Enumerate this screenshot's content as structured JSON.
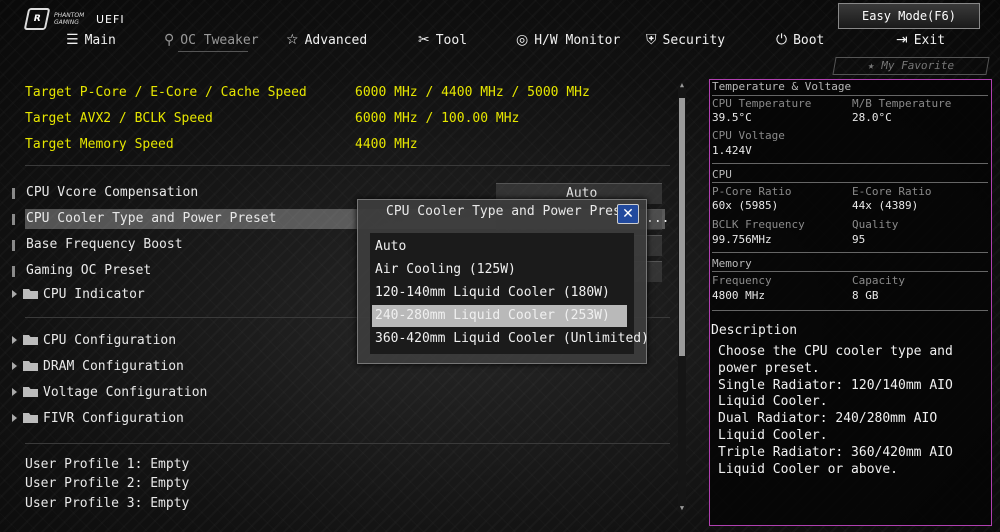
{
  "brand": {
    "logo_line1": "PHANTOM",
    "logo_line2": "GAMING",
    "logo_mark": "R",
    "uefi": "UEFI"
  },
  "header": {
    "easy_mode": "Easy Mode(F6)",
    "my_favorite": "My Favorite"
  },
  "nav": [
    {
      "label": "Main",
      "icon": "list-icon"
    },
    {
      "label": "OC Tweaker",
      "icon": "rocket-icon"
    },
    {
      "label": "Advanced",
      "icon": "star-icon"
    },
    {
      "label": "Tool",
      "icon": "wrench-icon"
    },
    {
      "label": "H/W Monitor",
      "icon": "monitor-icon"
    },
    {
      "label": "Security",
      "icon": "shield-icon"
    },
    {
      "label": "Boot",
      "icon": "power-icon"
    },
    {
      "label": "Exit",
      "icon": "exit-icon"
    }
  ],
  "targets": [
    {
      "label": "Target P-Core / E-Core / Cache Speed",
      "value": "6000 MHz / 4400 MHz / 5000 MHz"
    },
    {
      "label": "Target AVX2 / BCLK Speed",
      "value": "6000 MHz / 100.00 MHz"
    },
    {
      "label": "Target Memory Speed",
      "value": "4400 MHz"
    }
  ],
  "settings": [
    {
      "label": "CPU Vcore Compensation",
      "value": "Auto"
    },
    {
      "label": "CPU Cooler Type and Power Preset",
      "value": "..."
    },
    {
      "label": "Base Frequency Boost",
      "value": ""
    },
    {
      "label": "Gaming OC Preset",
      "value": ""
    }
  ],
  "cpu_indicator": "CPU Indicator",
  "folders": [
    "CPU Configuration",
    "DRAM Configuration",
    "Voltage Configuration",
    "FIVR Configuration"
  ],
  "profiles": [
    "User Profile 1: Empty",
    "User Profile 2: Empty",
    "User Profile 3: Empty"
  ],
  "panel": {
    "temp_heading": "Temperature & Voltage",
    "cpu_temp_label": "CPU Temperature",
    "cpu_temp": "39.5°C",
    "mb_temp_label": "M/B Temperature",
    "mb_temp": "28.0°C",
    "cpu_volt_label": "CPU Voltage",
    "cpu_volt": "1.424V",
    "cpu_heading": "CPU",
    "pcore_label": "P-Core Ratio",
    "pcore": "60x (5985)",
    "ecore_label": "E-Core Ratio",
    "ecore": "44x (4389)",
    "bclk_label": "BCLK Frequency",
    "bclk": "99.756MHz",
    "quality_label": "Quality",
    "quality": "95",
    "mem_heading": "Memory",
    "freq_label": "Frequency",
    "freq": "4800 MHz",
    "cap_label": "Capacity",
    "cap": "8 GB",
    "desc_title": "Description",
    "desc": "Choose the CPU cooler type and power preset.\nSingle Radiator: 120/140mm AIO Liquid Cooler.\nDual Radiator: 240/280mm AIO Liquid Cooler.\nTriple Radiator: 360/420mm AIO Liquid Cooler or above."
  },
  "popup": {
    "title": "CPU Cooler Type and Power Preset",
    "close": "✕",
    "options": [
      "Auto",
      "Air Cooling (125W)",
      "120-140mm Liquid Cooler (180W)",
      "240-280mm Liquid Cooler (253W)",
      "360-420mm Liquid Cooler (Unlimited)"
    ],
    "selected": "240-280mm Liquid Cooler (253W)"
  }
}
